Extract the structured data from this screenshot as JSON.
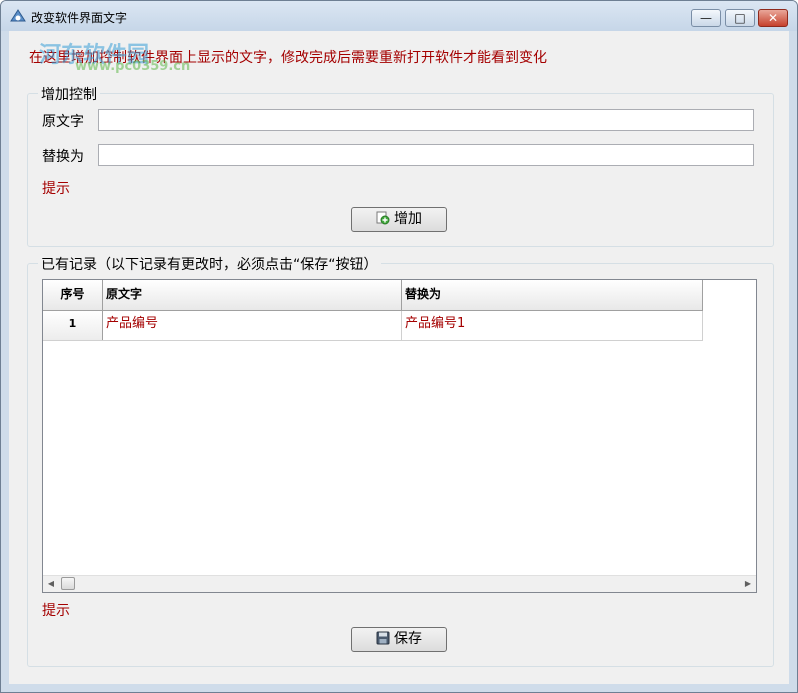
{
  "window": {
    "title": "改变软件界面文字",
    "watermark": "河东软件园",
    "watermark_url": "www.pc0359.cn",
    "controls": {
      "minimize": "—",
      "maximize": "□",
      "close": "✕"
    }
  },
  "instruction": "在这里增加控制软件界面上显示的文字，修改完成后需要重新打开软件才能看到变化",
  "add_group": {
    "legend": "增加控制",
    "original_label": "原文字",
    "original_value": "",
    "replace_label": "替换为",
    "replace_value": "",
    "hint": "提示",
    "add_button": "增加"
  },
  "records_group": {
    "legend": "已有记录（以下记录有更改时，必须点击“保存“按钮）",
    "columns": [
      "序号",
      "原文字",
      "替换为"
    ],
    "rows": [
      {
        "index": "1",
        "original": "产品编号",
        "replacement": "产品编号1"
      }
    ],
    "scroll": {
      "left": "◀",
      "right": "▶"
    },
    "hint": "提示",
    "save_button": "保存"
  },
  "colors": {
    "hint_red": "#a40000",
    "title_bar": "#c6d6e8",
    "close_red": "#c6412c"
  }
}
